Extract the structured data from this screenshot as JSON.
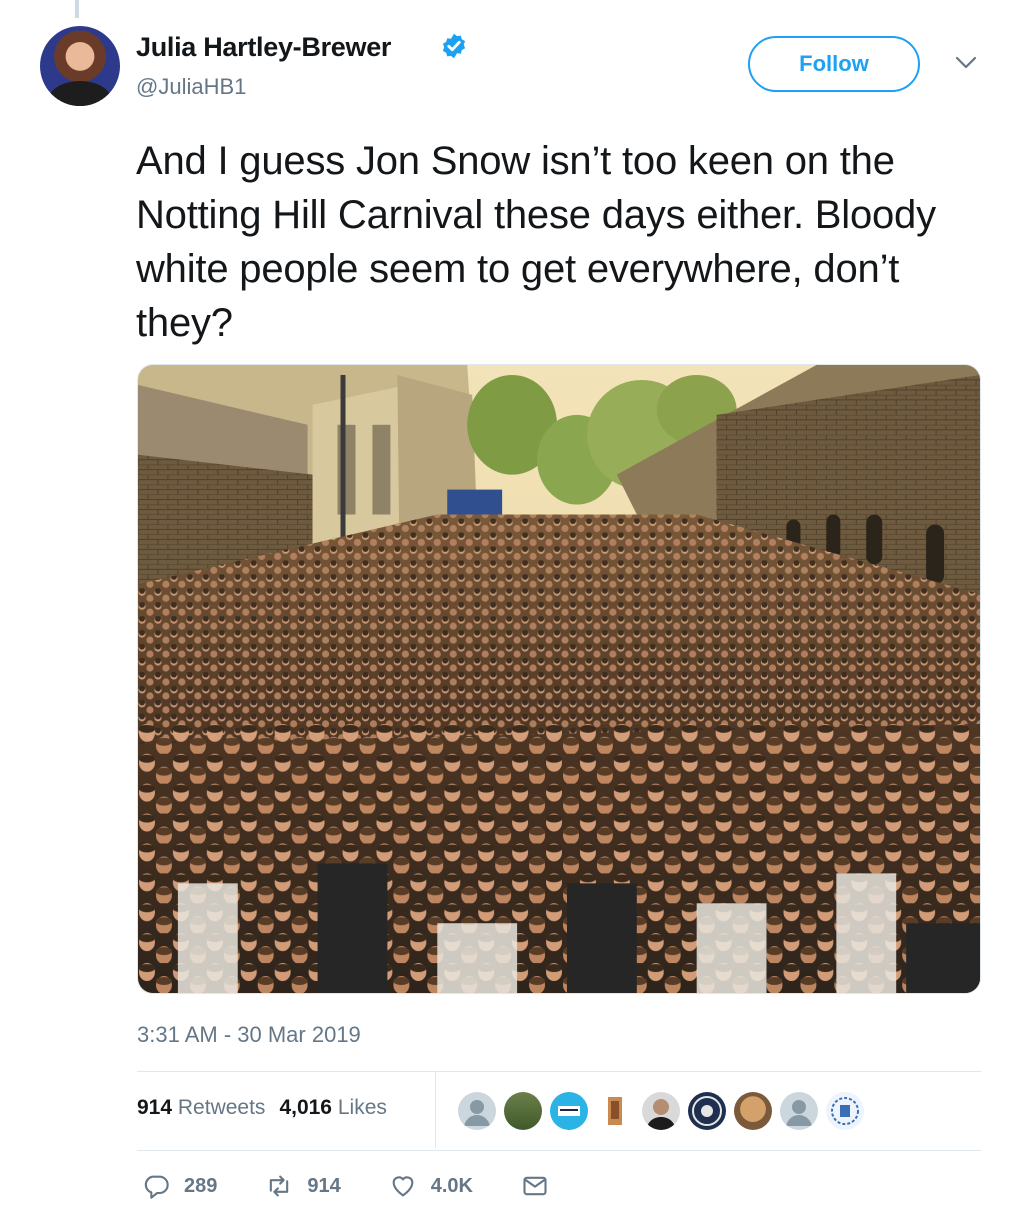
{
  "tweet": {
    "author_name": "Julia Hartley-Brewer",
    "handle": "@JuliaHB1",
    "follow_label": "Follow",
    "text": "And I guess Jon Snow isn’t too keen on the Notting Hill Carnival these days either. Bloody white people seem to get everywhere, don’t they?",
    "timestamp": "3:31 AM - 30 Mar 2019",
    "retweets_count": "914",
    "retweets_label": "Retweets",
    "likes_count": "4,016",
    "likes_label": "Likes"
  },
  "actions": {
    "replies": "289",
    "retweets": "914",
    "likes": "4.0K"
  },
  "icons": [
    "verified-badge-icon",
    "chevron-down-icon",
    "reply-icon",
    "retweet-icon",
    "like-icon",
    "direct-message-icon"
  ],
  "colors": {
    "accent": "#1da1f2",
    "secondary_text": "#657786",
    "primary_text": "#14171a",
    "border": "#e1e8ed"
  }
}
